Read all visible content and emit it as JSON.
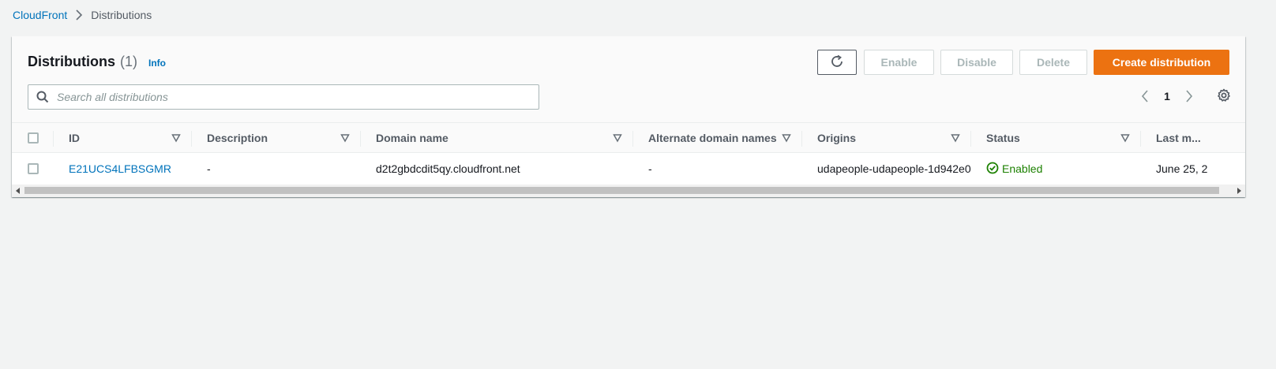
{
  "breadcrumb": {
    "root": "CloudFront",
    "current": "Distributions"
  },
  "panel": {
    "title": "Distributions",
    "count": "(1)",
    "info": "Info"
  },
  "toolbar": {
    "enable": "Enable",
    "disable": "Disable",
    "delete": "Delete",
    "create": "Create distribution"
  },
  "search": {
    "placeholder": "Search all distributions"
  },
  "pagination": {
    "page": "1"
  },
  "table": {
    "columns": [
      "ID",
      "Description",
      "Domain name",
      "Alternate domain names",
      "Origins",
      "Status",
      "Last m..."
    ],
    "rows": [
      {
        "id": "E21UCS4LFBSGMR",
        "description": "-",
        "domain": "d2t2gbdcdit5qy.cloudfront.net",
        "alternate": "-",
        "origins": "udapeople-udapeople-1d942e0",
        "status": "Enabled",
        "last_modified": "June 25, 2"
      }
    ]
  },
  "colors": {
    "primary": "#ec7211",
    "link": "#0073bb",
    "success": "#1d8102"
  }
}
